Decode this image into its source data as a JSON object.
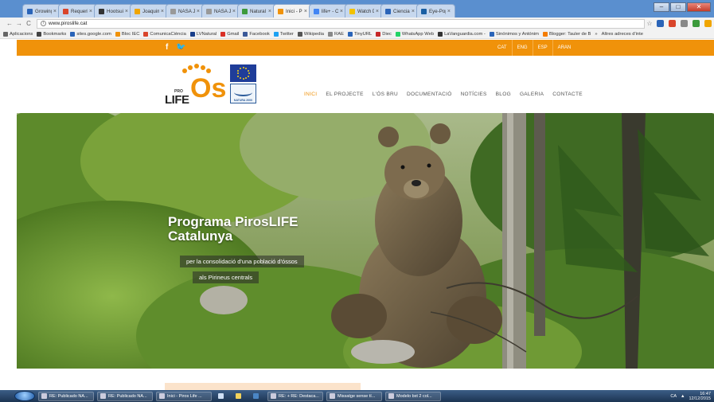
{
  "browser": {
    "tabs": [
      {
        "label": "Growing Param",
        "color": "#2a64b8"
      },
      {
        "label": "Requeriment",
        "color": "#d9452b"
      },
      {
        "label": "Hootsuite",
        "color": "#333333"
      },
      {
        "label": "Joaquim Elcac",
        "color": "#f0a500"
      },
      {
        "label": "NASA Just Cre",
        "color": "#999999"
      },
      {
        "label": "NASA Just Cre",
        "color": "#999999"
      },
      {
        "label": "Natural | Tres",
        "color": "#3c9a3c"
      },
      {
        "label": "Inici - Piros Lif",
        "color": "#f0920a",
        "active": true
      },
      {
        "label": "life+ - Cerca a",
        "color": "#4285f4"
      },
      {
        "label": "Watch David",
        "color": "#f2c200"
      },
      {
        "label": "Ciencia i Tecn",
        "color": "#2a64b8"
      },
      {
        "label": "Eye-Popping",
        "color": "#1a5fa3"
      }
    ],
    "tab_close": "×",
    "window_controls": {
      "minimize": "–",
      "maximize": "□",
      "close": "✕"
    },
    "nav": {
      "back": "←",
      "forward": "→",
      "reload": "C"
    },
    "url": "www.piroslife.cat",
    "url_info_icon": "i",
    "star": "☆",
    "bookmarks": [
      {
        "label": "Aplicacions",
        "color": "#666666"
      },
      {
        "label": "Bookmarks",
        "color": "#444444"
      },
      {
        "label": "sites.google.com",
        "color": "#2a64b8"
      },
      {
        "label": "Bloc IEC",
        "color": "#f0920a"
      },
      {
        "label": "ComunicaCiència",
        "color": "#d9452b"
      },
      {
        "label": "LVNatural",
        "color": "#1a3f8a"
      },
      {
        "label": "Gmail",
        "color": "#d93025"
      },
      {
        "label": "Facebook",
        "color": "#3b5998"
      },
      {
        "label": "Twitter",
        "color": "#1da1f2"
      },
      {
        "label": "Wikipedia",
        "color": "#555555"
      },
      {
        "label": "RAE",
        "color": "#888888"
      },
      {
        "label": "TinyURL",
        "color": "#2a64b8"
      },
      {
        "label": "Diec",
        "color": "#c62828"
      },
      {
        "label": "WhatsApp Web",
        "color": "#25d366"
      },
      {
        "label": "LaVanguardia.com -",
        "color": "#333333"
      },
      {
        "label": "Sinónimos y Antónim",
        "color": "#2a64b8"
      },
      {
        "label": "Blogger: Tauler de B",
        "color": "#f57d00"
      }
    ],
    "bookmarks_more": "»",
    "other_bookmarks": "Altres adreces d'inte"
  },
  "site": {
    "colors": {
      "accent": "#f0920a"
    },
    "social": {
      "facebook": "f",
      "twitter": "🐦"
    },
    "languages": [
      "CAT",
      "ENG",
      "ESP",
      "ARAN"
    ],
    "logo": {
      "pro": "PRO",
      "life": "LIFE",
      "os": "Os"
    },
    "natura_label": "NATURA 2000",
    "menu": [
      {
        "label": "INICI",
        "active": true
      },
      {
        "label": "EL PROJECTE"
      },
      {
        "label": "L'ÓS BRU"
      },
      {
        "label": "DOCUMENTACIÓ"
      },
      {
        "label": "NOTÍCIES"
      },
      {
        "label": "BLOG"
      },
      {
        "label": "GALERIA"
      },
      {
        "label": "CONTACTE"
      }
    ],
    "hero": {
      "title_line1": "Programa PirosLIFE",
      "title_line2": "Catalunya",
      "subtitle_line1": "per la consolidació d'una població d'óssos",
      "subtitle_line2": "als Pirineus centrals"
    }
  },
  "taskbar": {
    "tasks": [
      "RE: Publicado NA...",
      "RE: Publicado NA...",
      "Inici - Piros Life ...",
      "RE: + RE: Destaca...",
      "Missatge sense tí...",
      "Modelo bxt 2 col..."
    ],
    "tray_lang": "CA",
    "time": "16:47",
    "date": "12/12/2015"
  }
}
